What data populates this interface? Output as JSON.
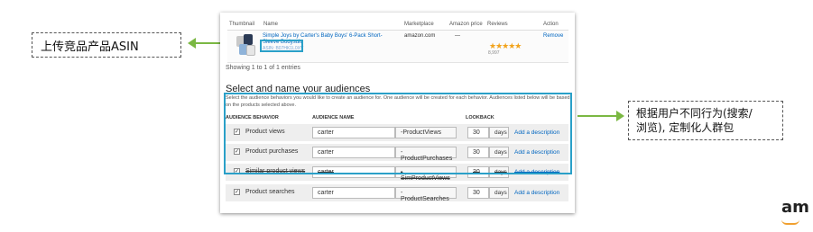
{
  "callouts": {
    "left": "上传竞品产品ASIN",
    "right_line1": "根据用户不同行为(搜索/",
    "right_line2": "浏览), 定制化人群包"
  },
  "product_table": {
    "headers": [
      "Thumbnail",
      "Name",
      "Marketplace",
      "Amazon price",
      "Reviews",
      "Action"
    ],
    "row": {
      "name": "Simple Joys by Carter's Baby Boys' 6-Pack Short-Sleeve Bodysuit",
      "asin": "ASIN: B07HK1L0XV",
      "marketplace": "amazon.com",
      "price": "—",
      "stars": "★★★★★",
      "review_count": "8,997",
      "action": "Remove"
    }
  },
  "showing_text": "Showing 1 to 1 of 1 entries",
  "audience_section": {
    "title": "Select and name your audiences",
    "instructions": "Select the audience behaviors you would like to create an audience for. One audience will be created for each behavior. Audiences listed below will be based on the products selected above.",
    "col_behavior": "AUDIENCE BEHAVIOR",
    "col_name": "AUDIENCE NAME",
    "col_lookback": "LOOKBACK",
    "days_unit": "days",
    "add_description": "Add a description",
    "rows": [
      {
        "behavior": "Product views",
        "name": "carter",
        "suffix": "-ProductViews",
        "lookback": "30"
      },
      {
        "behavior": "Product purchases",
        "name": "carter",
        "suffix": "-ProductPurchases",
        "lookback": "30"
      },
      {
        "behavior": "Similar product views",
        "name": "carter",
        "suffix": "-SimProductViews",
        "lookback": "30"
      },
      {
        "behavior": "Product searches",
        "name": "carter",
        "suffix": "-ProductSearches",
        "lookback": "30"
      }
    ]
  },
  "logo_text": "am",
  "colors": {
    "highlight": "#2aa0c8",
    "arrow": "#7bb843",
    "link": "#0066c0",
    "star": "#f2a31c"
  }
}
